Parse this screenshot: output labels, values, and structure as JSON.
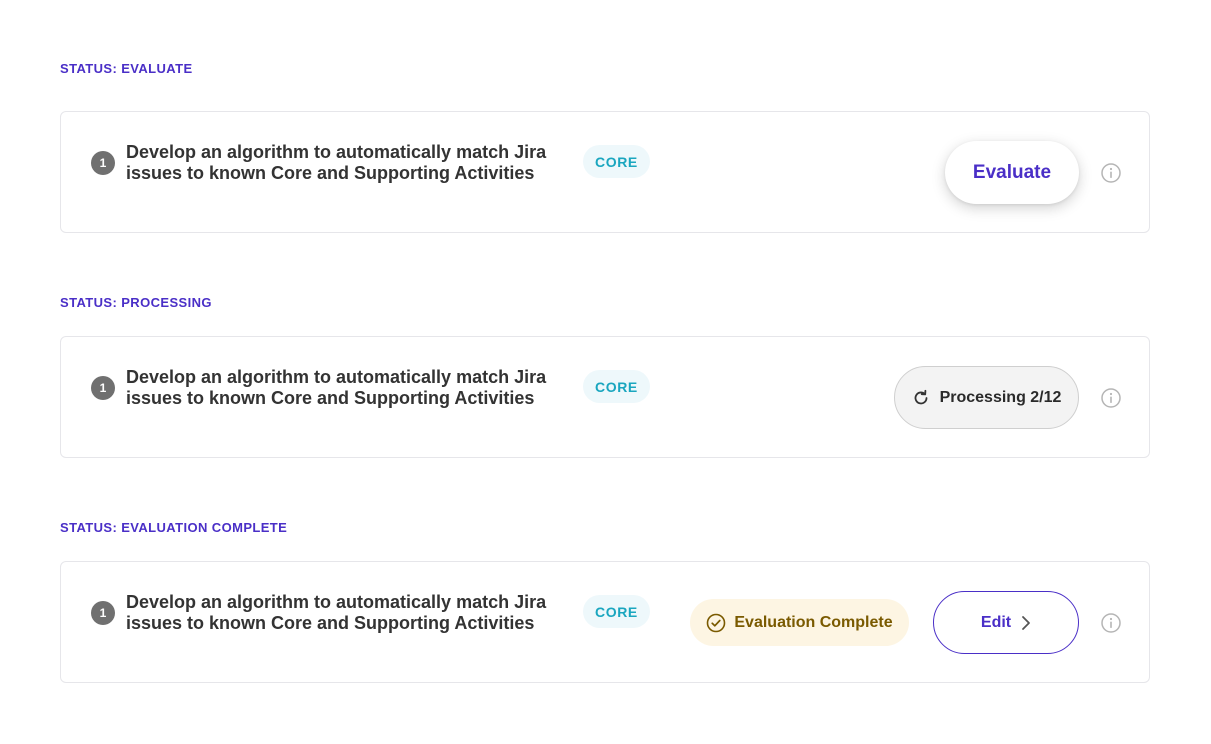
{
  "sections": [
    {
      "status_label": "STATUS: EVALUATE",
      "step_number": "1",
      "task_title": "Develop an algorithm to automatically match Jira issues to known Core and Supporting Activities",
      "badge": "CORE",
      "action_label": "Evaluate"
    },
    {
      "status_label": "STATUS: PROCESSING",
      "step_number": "1",
      "task_title": "Develop an algorithm to automatically match Jira issues to known Core and Supporting Activities",
      "badge": "CORE",
      "action_label": "Processing 2/12"
    },
    {
      "status_label": "STATUS: EVALUATION COMPLETE",
      "step_number": "1",
      "task_title": "Develop an algorithm to automatically match Jira issues to known Core and Supporting Activities",
      "badge": "CORE",
      "complete_label": "Evaluation Complete",
      "action_label": "Edit"
    }
  ],
  "colors": {
    "accent": "#4a2fc7",
    "badge_text": "#1aa6bf",
    "badge_bg": "#eef8fb",
    "complete_bg": "#fdf5e3",
    "complete_text": "#7a5a00"
  },
  "icons": {
    "info": "info-circle-icon",
    "refresh": "refresh-icon",
    "check": "check-circle-icon",
    "chevron": "chevron-right-icon"
  }
}
